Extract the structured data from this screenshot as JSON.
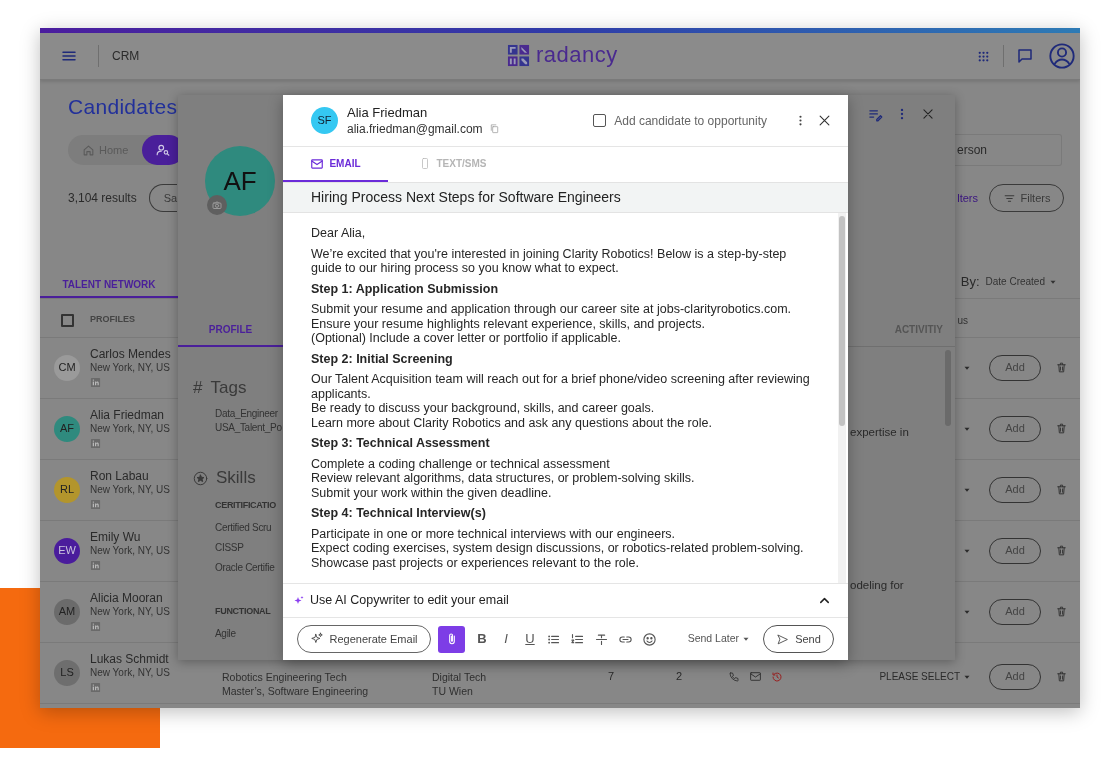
{
  "header": {
    "product": "CRM",
    "logo_text": "radancy"
  },
  "candidates": {
    "title": "Candidates",
    "nav": [
      {
        "kind": "home",
        "label": "Home",
        "selected": false
      },
      {
        "kind": "person-search",
        "selected": true
      }
    ],
    "results": "3,104 results",
    "saved_button": "Sa",
    "search_value": "erson",
    "clear_filters": "lters",
    "filters_button": "Filters",
    "tabs": [
      {
        "label": "TALENT NETWORK",
        "selected": true
      }
    ],
    "sort_label": "By:",
    "sort_value": "Date Created",
    "select_all": {
      "checked": false
    },
    "columns": [
      "PROFILES",
      "us"
    ],
    "rows": [
      {
        "initials": "CM",
        "name": "Carlos Mendes",
        "location": "New York, NY, US",
        "color": "#9a9a9a",
        "add": "Add"
      },
      {
        "initials": "AF",
        "name": "Alia Friedman",
        "location": "New York, NY, US",
        "color": "#2f8a7e",
        "add": "Add"
      },
      {
        "initials": "RL",
        "name": "Ron Labau",
        "location": "New York, NY, US",
        "color": "#b3952c",
        "add": "Add"
      },
      {
        "initials": "EW",
        "name": "Emily Wu",
        "location": "New York, NY, US",
        "color": "#4a1c9c",
        "add": "Add"
      },
      {
        "initials": "AM",
        "name": "Alicia Mooran",
        "location": "New York, NY, US",
        "color": "#6b6b6b",
        "add": "Add"
      },
      {
        "initials": "LS",
        "name": "Lukas Schmidt",
        "location": "New York, NY, US",
        "color": "#6e6e6e",
        "add": "Add",
        "details": [
          "Robotics Engineering Tech",
          "Master’s, Software Engineering"
        ],
        "org": [
          "Digital Tech",
          "TU Wien"
        ],
        "count_1": "7",
        "count_2": "2",
        "status": "PLEASE SELECT"
      }
    ]
  },
  "profile_panel": {
    "initials": "AF",
    "color": "#2f8a7e",
    "tabs": [
      {
        "label": "PROFILE",
        "selected": true
      },
      {
        "label": "ACTIVITIY",
        "selected": false
      }
    ],
    "tags_mark": "#",
    "tags_title": "Tags",
    "tags": [
      "Data_Engineer",
      "USA_Talent_Po"
    ],
    "skills_title": "Skills",
    "skill_groups": [
      {
        "title": "CERITIFICATIO",
        "items": [
          "Certified Scru",
          "CISSP",
          "Oracle Certifie"
        ]
      },
      {
        "title": "FUNCTIONAL",
        "items": [
          "Agile"
        ]
      }
    ],
    "side_texts": [
      "expertise in",
      "odeling for"
    ]
  },
  "email_dialog": {
    "avatar": "SF",
    "name": "Alia Friedman",
    "email": "alia.friedman@gmail.com",
    "add_to_opportunity": {
      "label": "Add candidate to opportunity",
      "checked": false
    },
    "tabs": [
      {
        "kind": "email",
        "label": "EMAIL",
        "selected": true
      },
      {
        "kind": "sms",
        "label": "TEXT/SMS",
        "selected": false
      }
    ],
    "subject": "Hiring Process Next Steps for Software Engineers",
    "body": [
      {
        "kind": "paragraph",
        "lines": [
          "Dear Alia,"
        ]
      },
      {
        "kind": "paragraph",
        "lines": [
          "We’re excited that you're interested in joining Clarity Robotics! Below is a step-by-step guide to our hiring process so you know what to expect."
        ]
      },
      {
        "kind": "heading",
        "lines": [
          "Step 1: Application Submission"
        ]
      },
      {
        "kind": "paragraph",
        "lines": [
          "Submit your resume and application through our career site at jobs-clarityrobotics.com.",
          "Ensure your resume highlights relevant experience, skills, and projects.",
          "(Optional) Include a cover letter or portfolio if applicable."
        ]
      },
      {
        "kind": "heading",
        "lines": [
          "Step 2: Initial Screening"
        ]
      },
      {
        "kind": "paragraph",
        "lines": [
          "Our Talent Acquisition team will reach out for a brief phone/video screening after reviewing applicants.",
          "Be ready to discuss your background, skills, and career goals.",
          "Learn more about Clarity Robotics and ask any questions about the role."
        ]
      },
      {
        "kind": "heading",
        "lines": [
          "Step 3: Technical Assessment"
        ]
      },
      {
        "kind": "paragraph",
        "lines": [
          "Complete a coding challenge or technical assessment",
          "Review relevant algorithms, data structures, or problem-solving skills.",
          "Submit your work within the given deadline."
        ]
      },
      {
        "kind": "heading",
        "lines": [
          "Step 4: Technical Interview(s)"
        ]
      },
      {
        "kind": "paragraph",
        "lines": [
          "Participate in one or more technical interviews with our engineers.",
          "Expect coding exercises, system design discussions, or robotics-related problem-solving.",
          "Showcase past projects or experiences relevant to the role."
        ]
      }
    ],
    "ai_bar": "Use AI Copywriter to edit your email",
    "regenerate_button": "Regenerate Email",
    "format_buttons": [
      {
        "kind": "bold",
        "label": "B"
      },
      {
        "kind": "italic",
        "label": "I"
      },
      {
        "kind": "underline",
        "label": "U"
      }
    ],
    "send_later": "Send Later",
    "send_button": "Send"
  }
}
